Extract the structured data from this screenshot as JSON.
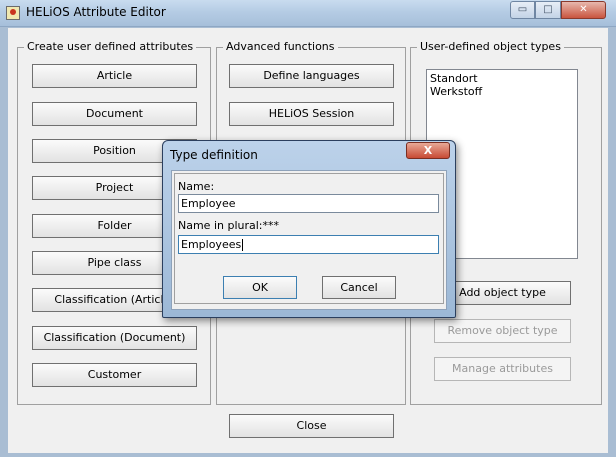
{
  "window": {
    "title": "HELiOS Attribute Editor",
    "min_symbol": "▭",
    "max_symbol": "□",
    "close_symbol": "✕"
  },
  "groups": {
    "create": {
      "label": "Create user defined attributes",
      "buttons": [
        "Article",
        "Document",
        "Position",
        "Project",
        "Folder",
        "Pipe class",
        "Classification (Article)",
        "Classification (Document)",
        "Customer"
      ]
    },
    "advanced": {
      "label": "Advanced functions",
      "buttons": [
        "Define languages",
        "HELiOS Session"
      ]
    },
    "object_types": {
      "label": "User-defined object types",
      "list_items": [
        "Standort",
        "Werkstoff"
      ],
      "add_button": "Add object type",
      "remove_button": "Remove object type",
      "manage_button": "Manage attributes"
    }
  },
  "close_button": "Close",
  "dialog": {
    "title": "Type definition",
    "close_symbol": "X",
    "name_label": "Name:",
    "name_value": "Employee",
    "plural_label": "Name in plural:***",
    "plural_value": "Employees",
    "ok_button": "OK",
    "cancel_button": "Cancel"
  },
  "icons": [
    "app-icon",
    "minimize-icon",
    "maximize-icon",
    "close-icon"
  ]
}
